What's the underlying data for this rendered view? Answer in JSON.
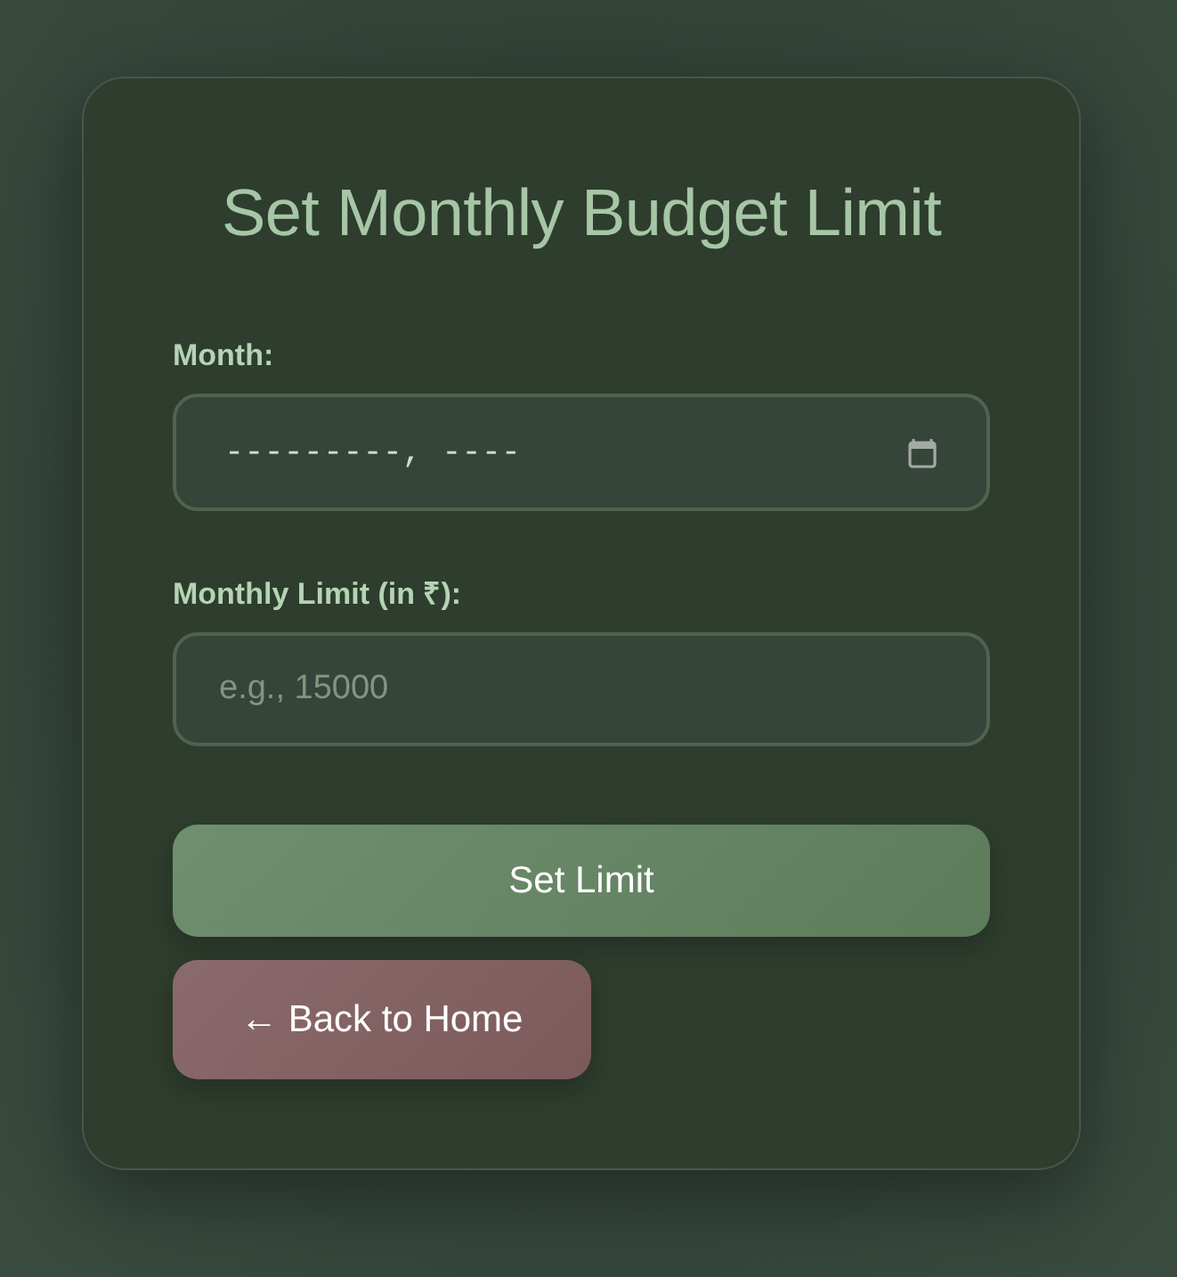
{
  "title": "Set Monthly Budget Limit",
  "fields": [
    {
      "kind": "month",
      "label": "Month:",
      "value": "---------, ----"
    },
    {
      "kind": "number",
      "label": "Monthly Limit (in ₹):",
      "placeholder": "e.g., 15000"
    }
  ],
  "buttons": [
    {
      "kind": "primary",
      "label": "Set Limit"
    },
    {
      "kind": "secondary",
      "label": "← Back to Home"
    }
  ]
}
